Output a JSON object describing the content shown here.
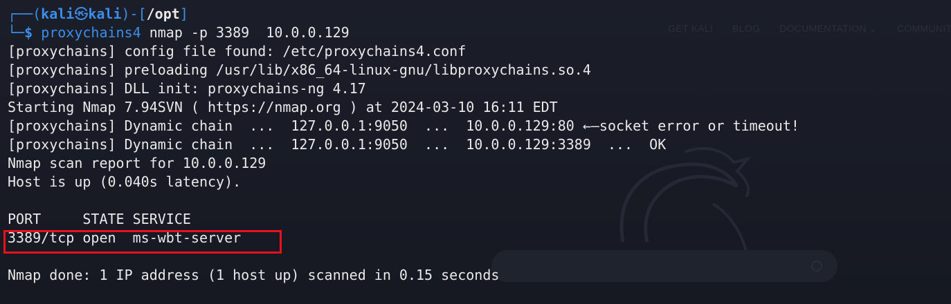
{
  "prompt": {
    "frame_open": "┌──(",
    "user": "kali",
    "skull": "㉿",
    "host": "kali",
    "frame_mid": ")-[",
    "path": "/opt",
    "frame_close": "]",
    "frame_bottom": "└─",
    "dollar": "$",
    "command": "proxychains4",
    "args": " nmap -p 3389  10.0.0.129"
  },
  "output": [
    "[proxychains] config file found: /etc/proxychains4.conf",
    "[proxychains] preloading /usr/lib/x86_64-linux-gnu/libproxychains.so.4",
    "[proxychains] DLL init: proxychains-ng 4.17",
    "Starting Nmap 7.94SVN ( https://nmap.org ) at 2024-03-10 16:11 EDT",
    "[proxychains] Dynamic chain  ...  127.0.0.1:9050  ...  10.0.0.129:80 ←—socket error or timeout!",
    "[proxychains] Dynamic chain  ...  127.0.0.1:9050  ...  10.0.0.129:3389  ...  OK",
    "Nmap scan report for 10.0.0.129",
    "Host is up (0.040s latency).",
    "",
    "PORT     STATE SERVICE",
    "3389/tcp open  ms-wbt-server",
    "",
    "Nmap done: 1 IP address (1 host up) scanned in 0.15 seconds"
  ],
  "background_site": {
    "nav": [
      "GET KALI",
      "BLOG",
      "DOCUMENTATION ⌄",
      "COMMUNITY"
    ]
  },
  "colors": {
    "prompt_blue": "#3b8eea",
    "text": "#e9e9ea",
    "background": "#1b1e29",
    "highlight": "#e8111c"
  }
}
